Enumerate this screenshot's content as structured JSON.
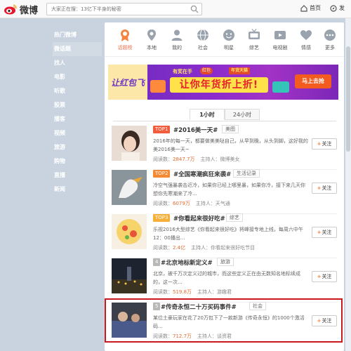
{
  "app": {
    "logo_text": "微博"
  },
  "search": {
    "placeholder": "大家正在搜：13亿下半身的秘密"
  },
  "topnav": {
    "home_label": "首页",
    "discover_label": "发"
  },
  "sidebar": {
    "items": [
      {
        "label": "热门微博",
        "active": false
      },
      {
        "label": "微话题",
        "active": true
      },
      {
        "label": "找人",
        "active": false
      },
      {
        "label": "电影",
        "active": false
      },
      {
        "label": "听歌",
        "active": false
      },
      {
        "label": "股票",
        "active": false
      },
      {
        "label": "播客",
        "active": false
      },
      {
        "label": "视频",
        "active": false
      },
      {
        "label": "旅游",
        "active": false
      },
      {
        "label": "购物",
        "active": false
      },
      {
        "label": "直播",
        "active": false
      },
      {
        "label": "新闻",
        "active": false
      }
    ]
  },
  "categories": [
    {
      "label": "话题榜",
      "icon": "trophy-icon",
      "active": true
    },
    {
      "label": "本地",
      "icon": "location-pin-icon"
    },
    {
      "label": "我的",
      "icon": "person-icon"
    },
    {
      "label": "社会",
      "icon": "globe-icon"
    },
    {
      "label": "明星",
      "icon": "star-face-icon"
    },
    {
      "label": "综艺",
      "icon": "tv-icon"
    },
    {
      "label": "电视剧",
      "icon": "film-icon"
    },
    {
      "label": "情感",
      "icon": "heart-icon"
    },
    {
      "label": "更多",
      "icon": "more-dots-icon"
    }
  ],
  "banner": {
    "left_text": "让红包飞",
    "top_text": "有奖在手",
    "tag1": "红包",
    "tag2": "年货天猫",
    "main_text": "让你年货折上折!",
    "button_text": "马上去抢"
  },
  "tabs": [
    {
      "label": "1小时",
      "active": true
    },
    {
      "label": "24小时",
      "active": false
    }
  ],
  "labels": {
    "read": "阅读数：",
    "host": "主持人：",
    "follow": "关注"
  },
  "topics": [
    {
      "rank_label": "TOP1",
      "rank_color": "#f25b3b",
      "title": "#2016美一天#",
      "tag": "美图",
      "desc": "2016年的每一天，都要做美美哒自己，从早到晚，从头到脚，这好我的美2016美一天~",
      "reads": "2847.7万",
      "host": "微博美女"
    },
    {
      "rank_label": "TOP2",
      "rank_color": "#f58a34",
      "title": "#全国寒潮疯狂来袭#",
      "tag": "生活记录",
      "desc": "冷空气强暴袭击近冷，如果你已经上哪里暴，如果你冷，接下来几天你想你先寒潮来了冷...",
      "reads": "6079万",
      "host": "天气通"
    },
    {
      "rank_label": "TOP3",
      "rank_color": "#f6b03a",
      "title": "#你看起来很好吃#",
      "tag": "综艺",
      "desc": "乐视2016大型综艺《你看起来很好吃》将峰接专地上线，每周六中午12：00播出...",
      "reads": "2.4亿",
      "host": "你看起来很好吃节目"
    },
    {
      "rank_label": "4",
      "rank_color": "#b8b8b8",
      "title": "#北京地标新定义#",
      "tag": "旅游",
      "desc": "北京，被千万次定义过的城市，而这些定义正在由无数知名地标续成的，这一次...",
      "reads": "519.8万",
      "host": "游趣君"
    },
    {
      "rank_label": "5",
      "rank_color": "#b8b8b8",
      "title": "#传奇永恒二十万买码事件#",
      "tag": "社会",
      "desc": "某位土豪玩家在花了20万包下了一款新游《传奇永恒》的1000个激活码...",
      "reads": "712.7万",
      "host": "谈资君"
    }
  ]
}
